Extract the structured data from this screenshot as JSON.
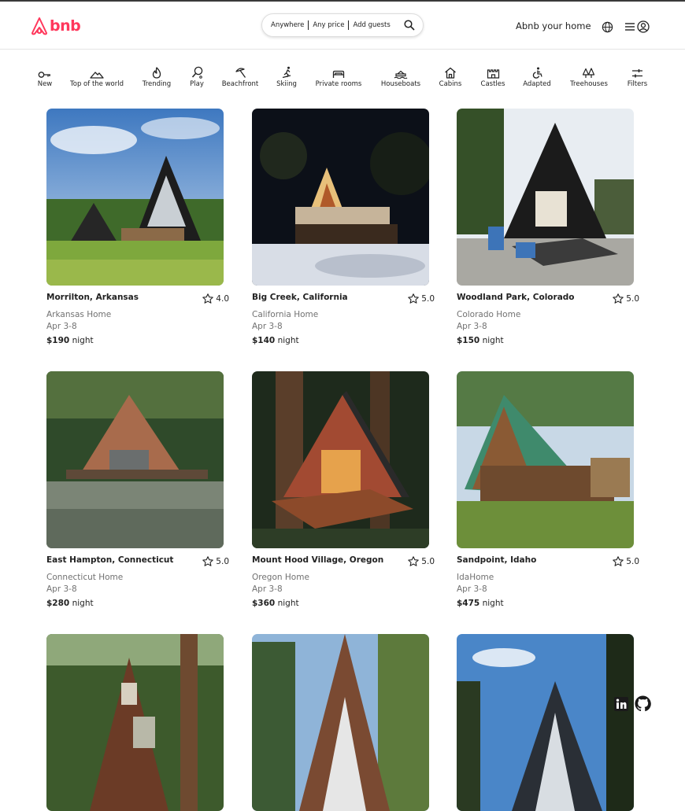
{
  "brand": {
    "logo_text": "bnb",
    "color": "#ff385c"
  },
  "search": {
    "anywhere": "Anywhere",
    "any_price": "Any price",
    "add_guests": "Add guests"
  },
  "header": {
    "host_label": "Abnb your home"
  },
  "categories": [
    {
      "label": "New",
      "icon": "key-icon"
    },
    {
      "label": "Top of the world",
      "icon": "mountain-icon"
    },
    {
      "label": "Trending",
      "icon": "flame-icon"
    },
    {
      "label": "Play",
      "icon": "search-play-icon"
    },
    {
      "label": "Beachfront",
      "icon": "umbrella-icon"
    },
    {
      "label": "Skiing",
      "icon": "skier-icon"
    },
    {
      "label": "Private rooms",
      "icon": "bed-icon"
    },
    {
      "label": "Houseboats",
      "icon": "houseboat-icon"
    },
    {
      "label": "Cabins",
      "icon": "cabin-icon"
    },
    {
      "label": "Castles",
      "icon": "castle-icon"
    },
    {
      "label": "Adapted",
      "icon": "wheelchair-icon"
    },
    {
      "label": "Treehouses",
      "icon": "trees-icon"
    },
    {
      "label": "Filters",
      "icon": "sliders-icon"
    }
  ],
  "listings": [
    {
      "location": "Morrilton, Arkansas",
      "rating": "4.0",
      "subtitle": "Arkansas Home",
      "dates": "Apr 3-8",
      "price": "$190",
      "price_unit": "night"
    },
    {
      "location": "Big Creek, California",
      "rating": "5.0",
      "subtitle": "California Home",
      "dates": "Apr 3-8",
      "price": "$140",
      "price_unit": "night"
    },
    {
      "location": "Woodland Park, Colorado",
      "rating": "5.0",
      "subtitle": "Colorado Home",
      "dates": "Apr 3-8",
      "price": "$150",
      "price_unit": "night"
    },
    {
      "location": "East Hampton, Connecticut",
      "rating": "5.0",
      "subtitle": "Connecticut Home",
      "dates": "Apr 3-8",
      "price": "$280",
      "price_unit": "night"
    },
    {
      "location": "Mount Hood Village, Oregon",
      "rating": "5.0",
      "subtitle": "Oregon Home",
      "dates": "Apr 3-8",
      "price": "$360",
      "price_unit": "night"
    },
    {
      "location": "Sandpoint, Idaho",
      "rating": "5.0",
      "subtitle": "IdaHome",
      "dates": "Apr 3-8",
      "price": "$475",
      "price_unit": "night"
    },
    {
      "location": "",
      "rating": "",
      "subtitle": "",
      "dates": "",
      "price": "",
      "price_unit": ""
    },
    {
      "location": "",
      "rating": "",
      "subtitle": "",
      "dates": "",
      "price": "",
      "price_unit": ""
    },
    {
      "location": "",
      "rating": "",
      "subtitle": "",
      "dates": "",
      "price": "",
      "price_unit": ""
    }
  ],
  "floating_icons": [
    "linkedin-icon",
    "github-icon"
  ]
}
